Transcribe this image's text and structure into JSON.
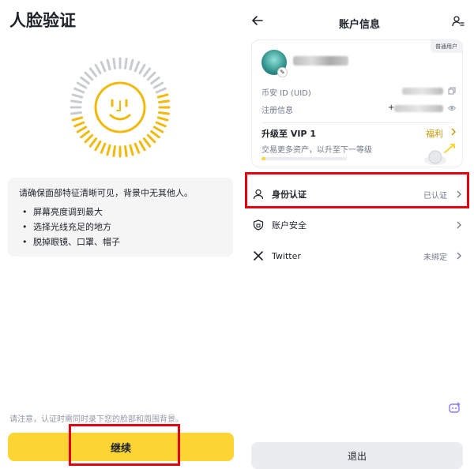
{
  "left": {
    "title": "人脸验证",
    "tips_intro": "请确保面部特征清晰可见，背景中无其他人。",
    "tips": [
      "屏幕亮度调到最大",
      "选择光线充足的地方",
      "脱掉眼镜、口罩、帽子"
    ],
    "notice": "请注意，认证时需同时录下您的脸部和周围背景。",
    "continue_label": "继续",
    "accent_color": "#fcd535"
  },
  "right": {
    "title": "账户信息",
    "badge": "普通用户",
    "uid_label": "币安 ID (UID)",
    "reg_label": "注册信息",
    "reg_prefix": "+",
    "vip_title": "升级至 VIP 1",
    "vip_benefit": "福利",
    "vip_desc": "交易更多资产，以升至下一等级",
    "vip_progress": 0.05,
    "menu": [
      {
        "label": "身份认证",
        "status": "已认证",
        "icon": "person-icon"
      },
      {
        "label": "账户安全",
        "status": "",
        "icon": "shield-icon"
      },
      {
        "label": "Twitter",
        "status": "未绑定",
        "icon": "x-twitter-icon"
      }
    ],
    "logout_label": "退出"
  }
}
